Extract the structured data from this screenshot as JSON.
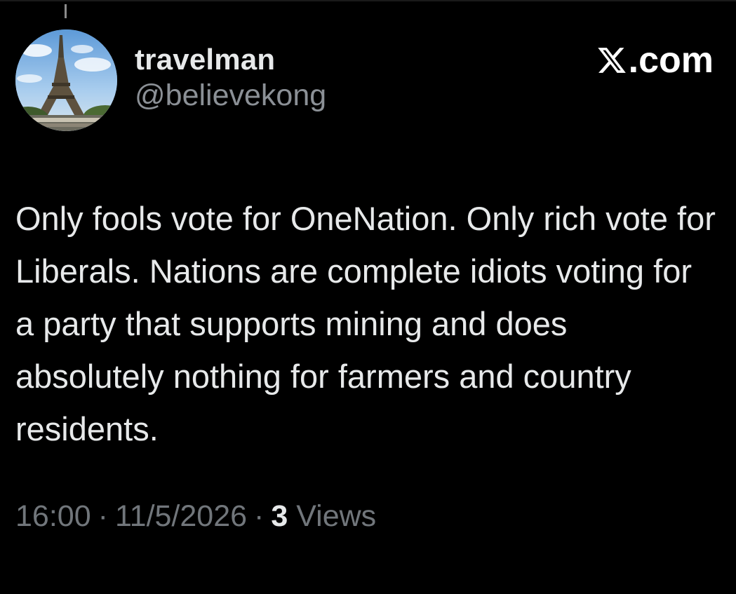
{
  "post": {
    "author": {
      "display_name": "travelman",
      "handle": "@believekong",
      "avatar_icon": "eiffel-tower-avatar"
    },
    "brand": {
      "icon": "x-logo-icon",
      "label": ".com"
    },
    "text": "Only fools vote for OneNation. Only rich vote for Liberals. Nations are complete idiots voting for a party that supports mining and does absolutely nothing for farmers and country residents.",
    "meta": {
      "time": "16:00",
      "separator": "·",
      "date": "11/5/2026",
      "views_count": "3",
      "views_label": "Views"
    }
  },
  "colors": {
    "background": "#000000",
    "primary_text": "#e7e9ea",
    "secondary_text": "#71767b"
  }
}
